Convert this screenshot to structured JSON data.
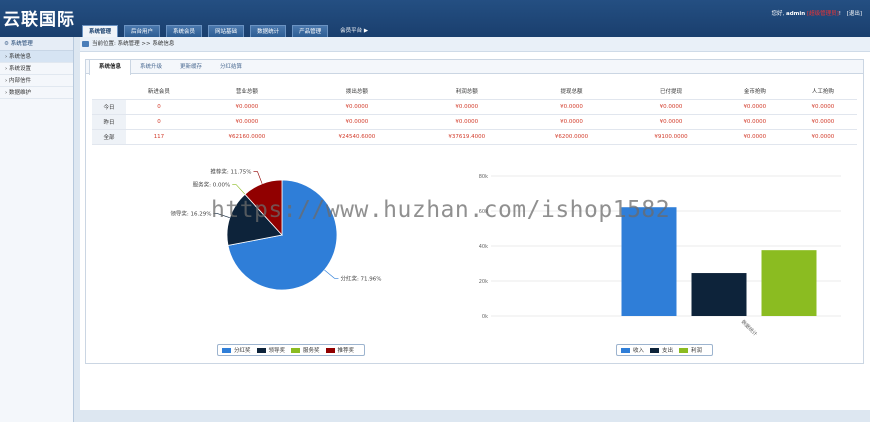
{
  "app": {
    "logo": "云联国际"
  },
  "nav": {
    "tabs": [
      "系统管理",
      "后台用户",
      "系统会员",
      "网站基础",
      "数据统计",
      "产品管理"
    ],
    "platform": "会员平台"
  },
  "user": {
    "greeting": "您好,",
    "name": "admin",
    "red_text": "[超级管理员]",
    "suffix": "!",
    "logout": "[退出]"
  },
  "sidebar": {
    "heading": "系统管理",
    "items": [
      "系统信息",
      "系统设置",
      "内部信件",
      "数据维护"
    ]
  },
  "breadcrumb": "当前位置: 系统管理 >> 系统信息",
  "subtabs": [
    "系统信息",
    "系统升级",
    "更新缓存",
    "分红结算"
  ],
  "stats": {
    "headers": [
      "新进会员",
      "营业总额",
      "拨出总额",
      "利润总额",
      "提现总额",
      "已付提现",
      "金币抢购",
      "人工抢购"
    ],
    "rows": [
      {
        "label": "今日",
        "values": [
          "0",
          "¥0.0000",
          "¥0.0000",
          "¥0.0000",
          "¥0.0000",
          "¥0.0000",
          "¥0.0000",
          "¥0.0000"
        ]
      },
      {
        "label": "昨日",
        "values": [
          "0",
          "¥0.0000",
          "¥0.0000",
          "¥0.0000",
          "¥0.0000",
          "¥0.0000",
          "¥0.0000",
          "¥0.0000"
        ]
      },
      {
        "label": "全部",
        "values": [
          "117",
          "¥62160.0000",
          "¥24540.6000",
          "¥37619.4000",
          "¥6200.0000",
          "¥9100.0000",
          "¥0.0000",
          "¥0.0000"
        ]
      }
    ]
  },
  "watermark": "https://www.huzhan.com/ishop1582",
  "chart_data": [
    {
      "type": "pie",
      "series": [
        {
          "name": "分红奖",
          "value": 71.96,
          "label": "分红奖: 71.96%",
          "color": "#2f7ed8"
        },
        {
          "name": "领导奖",
          "value": 16.29,
          "label": "领导奖: 16.29%",
          "color": "#0d233a"
        },
        {
          "name": "服务奖",
          "value": 0.0,
          "label": "服务奖: 0.00%",
          "color": "#8bbc21"
        },
        {
          "name": "推荐奖",
          "value": 11.75,
          "label": "推荐奖: 11.75%",
          "color": "#910000"
        }
      ]
    },
    {
      "type": "bar",
      "ylim": [
        0,
        80000
      ],
      "yticks": [
        "0k",
        "20k",
        "40k",
        "60k",
        "80k"
      ],
      "xlabel": "数据统计",
      "series": [
        {
          "name": "收入",
          "value": 62160,
          "color": "#2f7ed8"
        },
        {
          "name": "支出",
          "value": 24540.6,
          "color": "#0d233a"
        },
        {
          "name": "利润",
          "value": 37619.4,
          "color": "#8bbc21"
        }
      ]
    }
  ]
}
